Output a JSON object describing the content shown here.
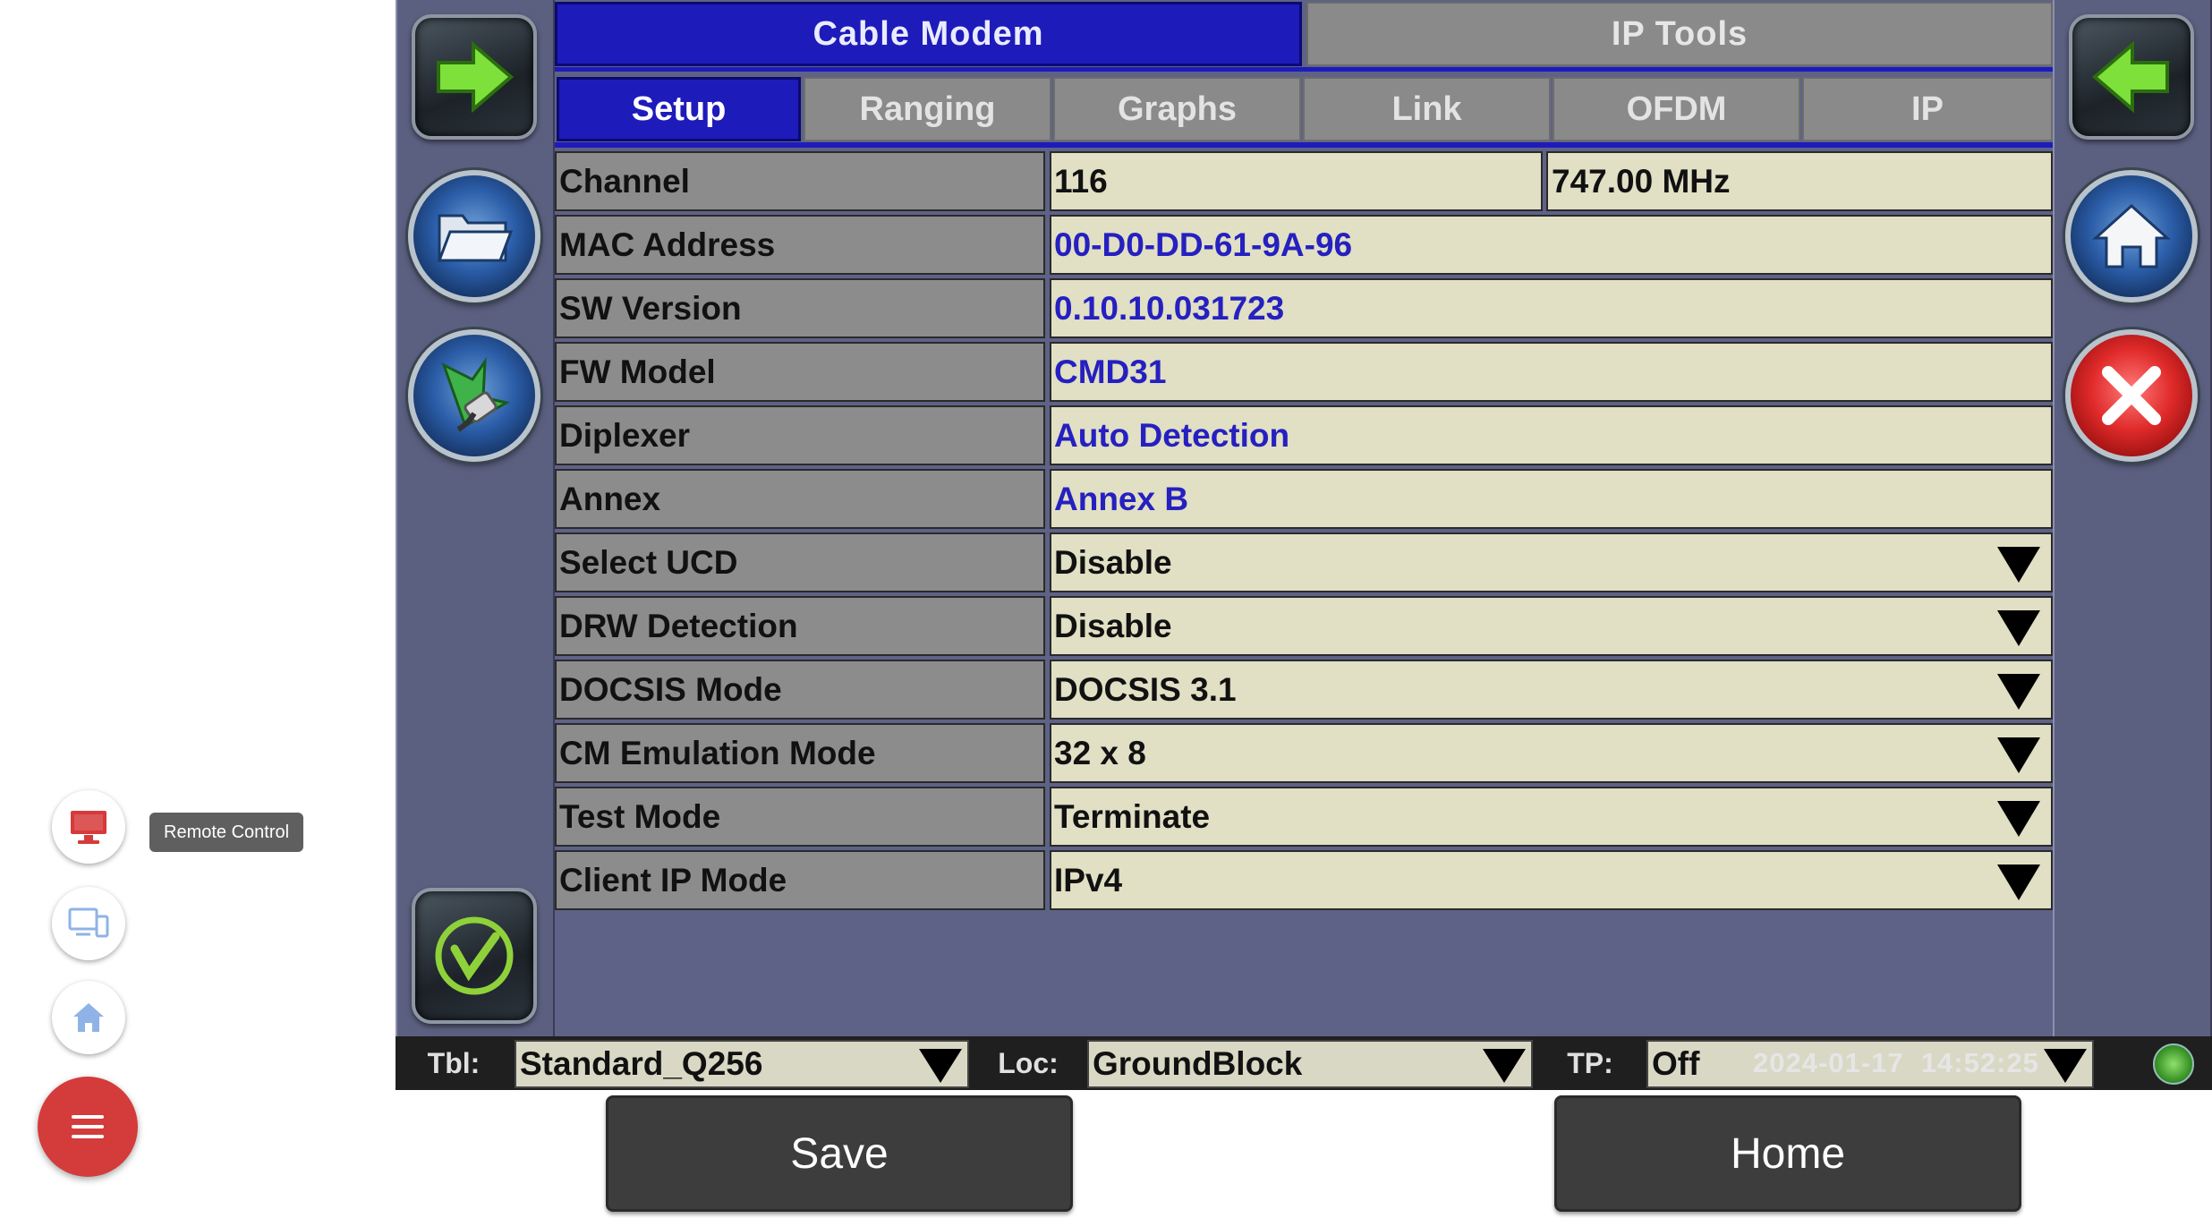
{
  "tabs": {
    "cable_modem": "Cable Modem",
    "ip_tools": "IP Tools"
  },
  "subtabs": [
    "Setup",
    "Ranging",
    "Graphs",
    "Link",
    "OFDM",
    "IP"
  ],
  "rows": [
    {
      "label": "Channel",
      "value": "116",
      "value2": "747.00 MHz"
    },
    {
      "label": "MAC Address",
      "value": "00-D0-DD-61-9A-96"
    },
    {
      "label": "SW Version",
      "value": "0.10.10.031723"
    },
    {
      "label": "FW Model",
      "value": "CMD31"
    },
    {
      "label": "Diplexer",
      "value": "Auto Detection"
    },
    {
      "label": "Annex",
      "value": "Annex B"
    },
    {
      "label": "Select UCD",
      "value": "Disable"
    },
    {
      "label": "DRW Detection",
      "value": "Disable"
    },
    {
      "label": "DOCSIS Mode",
      "value": "DOCSIS 3.1"
    },
    {
      "label": "CM Emulation Mode",
      "value": "32 x 8"
    },
    {
      "label": "Test Mode",
      "value": "Terminate"
    },
    {
      "label": "Client IP Mode",
      "value": "IPv4"
    }
  ],
  "statusbar": {
    "tbl_label": "Tbl:",
    "tbl_value": "Standard_Q256",
    "loc_label": "Loc:",
    "loc_value": "GroundBlock",
    "tp_label": "TP:",
    "tp_value": "Off",
    "date": "2024-01-17",
    "time": "14:52:25"
  },
  "buttons": {
    "save": "Save",
    "home": "Home"
  },
  "floating": {
    "tooltip": "Remote Control"
  },
  "icons": {
    "left": [
      "arrow-right-icon",
      "folder-icon",
      "plug-icon",
      "veex-logo-icon"
    ],
    "right": [
      "arrow-left-icon",
      "home-icon",
      "close-icon"
    ],
    "floating": [
      "monitor-icon",
      "devices-icon",
      "home-icon",
      "menu-icon"
    ]
  },
  "colors": {
    "tab_active": "#1e1bbb",
    "value_blue": "#2520c0",
    "close_red": "#e02a2a",
    "menu_red": "#d43b3b"
  }
}
